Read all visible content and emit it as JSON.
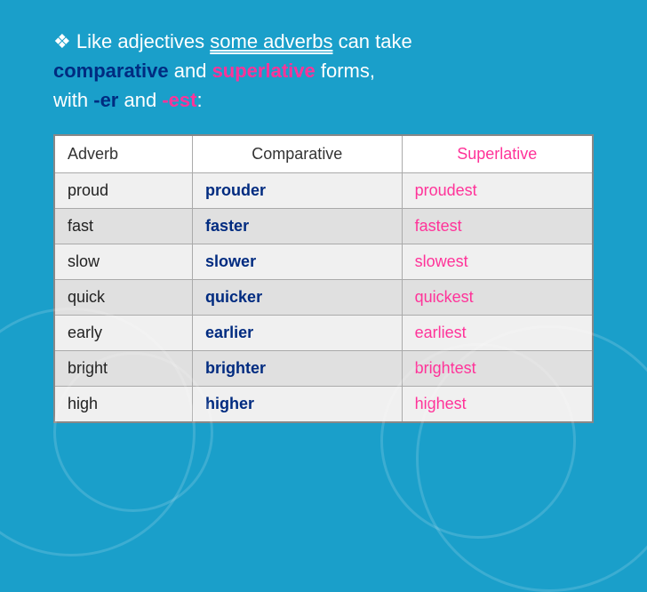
{
  "intro": {
    "line1_before": "Like adjectives ",
    "line1_highlight": "some adverbs",
    "line1_after": " can take",
    "line2_bold_blue": "comparative",
    "line2_middle": " and ",
    "line2_bold_pink": "superlative",
    "line2_after": " forms,",
    "line3_before": "with ",
    "line3_dash_blue": "-er",
    "line3_middle": " and ",
    "line3_dash_pink": "-est",
    "line3_colon": ":"
  },
  "table": {
    "headers": [
      "Adverb",
      "Comparative",
      "Superlative"
    ],
    "rows": [
      [
        "proud",
        "prouder",
        "proudest"
      ],
      [
        "fast",
        "faster",
        "fastest"
      ],
      [
        "slow",
        "slower",
        "slowest"
      ],
      [
        "quick",
        "quicker",
        "quickest"
      ],
      [
        "early",
        "earlier",
        "earliest"
      ],
      [
        "bright",
        "brighter",
        "brightest"
      ],
      [
        "high",
        "higher",
        "highest"
      ]
    ]
  }
}
